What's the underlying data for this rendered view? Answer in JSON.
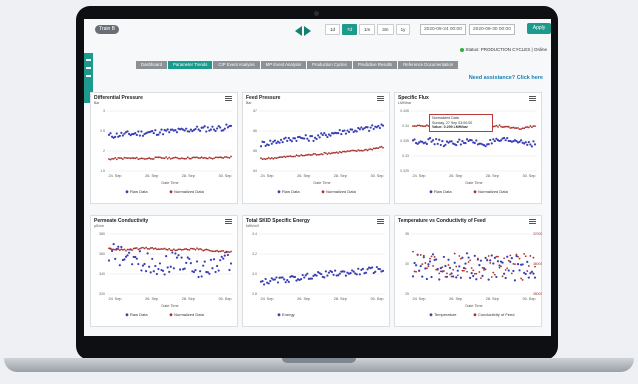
{
  "header": {
    "team_label": "Train B",
    "ranges": [
      {
        "label": "1d",
        "active": false
      },
      {
        "label": "7d",
        "active": true
      },
      {
        "label": "1m",
        "active": false
      },
      {
        "label": "3m",
        "active": false
      },
      {
        "label": "1y",
        "active": false
      }
    ],
    "date_from": "2020-09-24 00:00",
    "date_to": "2020-09-30 00:00",
    "apply_label": "Apply",
    "status": "Status: PRODUCTION CYCLES | Online"
  },
  "nav": {
    "tabs": [
      {
        "label": "Dashboard",
        "active": false
      },
      {
        "label": "Parameter Trends",
        "active": true
      },
      {
        "label": "CIP Event Analysis",
        "active": false
      },
      {
        "label": "MP Event Analysis",
        "active": false
      },
      {
        "label": "Production Cycles",
        "active": false
      },
      {
        "label": "Predictive Results",
        "active": false
      },
      {
        "label": "Reference Documentation",
        "active": false
      }
    ]
  },
  "assistance_label": "Need assistance? Click here",
  "colors": {
    "accent": "#1c9a8c",
    "blue": "#3a3fb5",
    "red": "#a8332e"
  },
  "chart_data": [
    {
      "type": "scatter",
      "title": "Differential Pressure",
      "unit": "Bar",
      "yticks": [
        "3",
        "2.5",
        "2",
        "1.5"
      ],
      "ylim": [
        1.5,
        3
      ],
      "x_ticks": [
        "24. Sep",
        "26. Sep",
        "28. Sep",
        "30. Sep"
      ],
      "xlabel": "Date Time",
      "series": [
        {
          "name": "Raw Data",
          "color": "#3a3fb5",
          "values": [
            2.38,
            2.42,
            2.45,
            2.48,
            2.5,
            2.55,
            2.56,
            2.6
          ]
        },
        {
          "name": "Normalized Data",
          "color": "#a8332e",
          "values": [
            1.8,
            1.82,
            1.81,
            1.83,
            1.82,
            1.83,
            1.82,
            1.85
          ]
        }
      ]
    },
    {
      "type": "scatter",
      "title": "Feed Pressure",
      "unit": "Bar",
      "yticks": [
        "67",
        "66",
        "65",
        "64"
      ],
      "ylim": [
        63,
        67
      ],
      "x_ticks": [
        "24. Sep",
        "26. Sep",
        "28. Sep",
        "30. Sep"
      ],
      "xlabel": "Date Time",
      "series": [
        {
          "name": "Raw Data",
          "color": "#3a3fb5",
          "values": [
            64.8,
            65.0,
            65.2,
            65.2,
            65.5,
            65.7,
            65.8,
            66.0
          ]
        },
        {
          "name": "Normalized Data",
          "color": "#a8332e",
          "values": [
            63.8,
            63.9,
            64.0,
            64.1,
            64.2,
            64.3,
            64.4,
            64.6
          ]
        }
      ]
    },
    {
      "type": "scatter",
      "title": "Specific Flux",
      "unit": "LMH/bar",
      "yticks": [
        "0.345",
        "0.34",
        "0.335",
        "0.33",
        "0.325"
      ],
      "ylim": [
        0.325,
        0.345
      ],
      "x_ticks": [
        "24. Sep",
        "26. Sep",
        "28. Sep",
        "30. Sep"
      ],
      "xlabel": "Date Time",
      "tooltip": {
        "series": "Normalized Data",
        "date": "Sunday, 27 Sep 03:00:00",
        "value": "Value: 0.299 LMH/bar"
      },
      "series": [
        {
          "name": "Raw Data",
          "color": "#3a3fb5",
          "values": [
            0.335,
            0.335,
            0.334,
            0.335,
            0.334,
            0.335,
            0.335,
            0.334
          ]
        },
        {
          "name": "Normalized Data",
          "color": "#a8332e",
          "values": [
            0.34,
            0.34,
            0.34,
            0.339,
            0.34,
            0.34,
            0.339,
            0.34
          ]
        }
      ]
    },
    {
      "type": "scatter",
      "title": "Permeate Conductivity",
      "unit": "µS/cm",
      "yticks": [
        "380",
        "360",
        "340",
        "320"
      ],
      "ylim": [
        320,
        380
      ],
      "x_ticks": [
        "24. Sep",
        "26. Sep",
        "28. Sep",
        "30. Sep"
      ],
      "xlabel": "Date Time",
      "series": [
        {
          "name": "Raw Data",
          "color": "#3a3fb5",
          "values": [
            362,
            356,
            352,
            348,
            355,
            343,
            350,
            354
          ]
        },
        {
          "name": "Normalized Data",
          "color": "#a8332e",
          "values": [
            365,
            364,
            366,
            365,
            364,
            365,
            363,
            362
          ]
        }
      ]
    },
    {
      "type": "scatter",
      "title": "Total SKID Specific Energy",
      "unit": "kWh/m3",
      "yticks": [
        "3.4",
        "3.2",
        "3.0",
        "2.8"
      ],
      "ylim": [
        2.75,
        3.4
      ],
      "x_ticks": [
        "24. Sep",
        "26. Sep",
        "28. Sep",
        "30. Sep"
      ],
      "xlabel": "",
      "series": [
        {
          "name": "Energy",
          "color": "#3a3fb5",
          "values": [
            2.88,
            2.9,
            2.92,
            2.95,
            2.97,
            2.98,
            3.0,
            3.02
          ]
        }
      ]
    },
    {
      "type": "scatter",
      "title": "Temperature vs Conductivity of Feed",
      "unit": "",
      "yticks": [
        "35",
        "30",
        "25"
      ],
      "ylim": [
        25,
        36
      ],
      "y2ticks": [
        "37000",
        "36000",
        "35000"
      ],
      "x_ticks": [
        "24. Sep",
        "26. Sep",
        "28. Sep",
        "30. Sep"
      ],
      "xlabel": "Date Time",
      "series": [
        {
          "name": "Temperature",
          "color": "#3a3fb5",
          "values": [
            30.5,
            30.0,
            29.8,
            30.2,
            29.6,
            30.1,
            29.7,
            30.0
          ]
        },
        {
          "name": "Conductivity of Feed",
          "color": "#a8332e",
          "values": [
            31.0,
            30.4,
            30.1,
            30.5,
            29.9,
            30.3,
            29.8,
            30.2
          ]
        }
      ]
    }
  ]
}
